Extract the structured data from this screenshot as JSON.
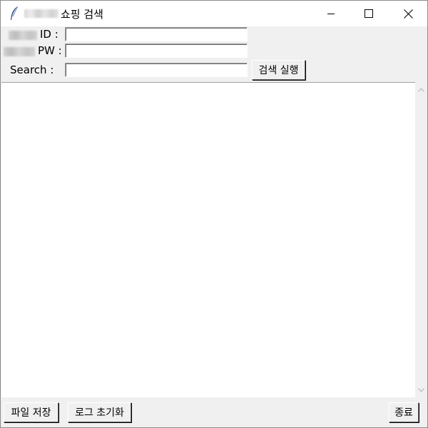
{
  "window": {
    "title": "쇼핑 검색",
    "title_prefix_redacted": true
  },
  "form": {
    "id_label": "ID :",
    "pw_label": "PW :",
    "search_label": "Search :",
    "id_value": "",
    "pw_value": "",
    "search_value": "",
    "search_button_label": "검색 실행"
  },
  "log": {
    "content": ""
  },
  "footer": {
    "save_button_label": "파일 저장",
    "reset_button_label": "로그 초기화",
    "exit_button_label": "종료"
  },
  "icons": {
    "app": "feather-icon",
    "minimize": "minimize-icon",
    "maximize": "maximize-icon",
    "close": "close-icon",
    "scroll_up": "chevron-up-icon",
    "scroll_down": "chevron-down-icon"
  }
}
